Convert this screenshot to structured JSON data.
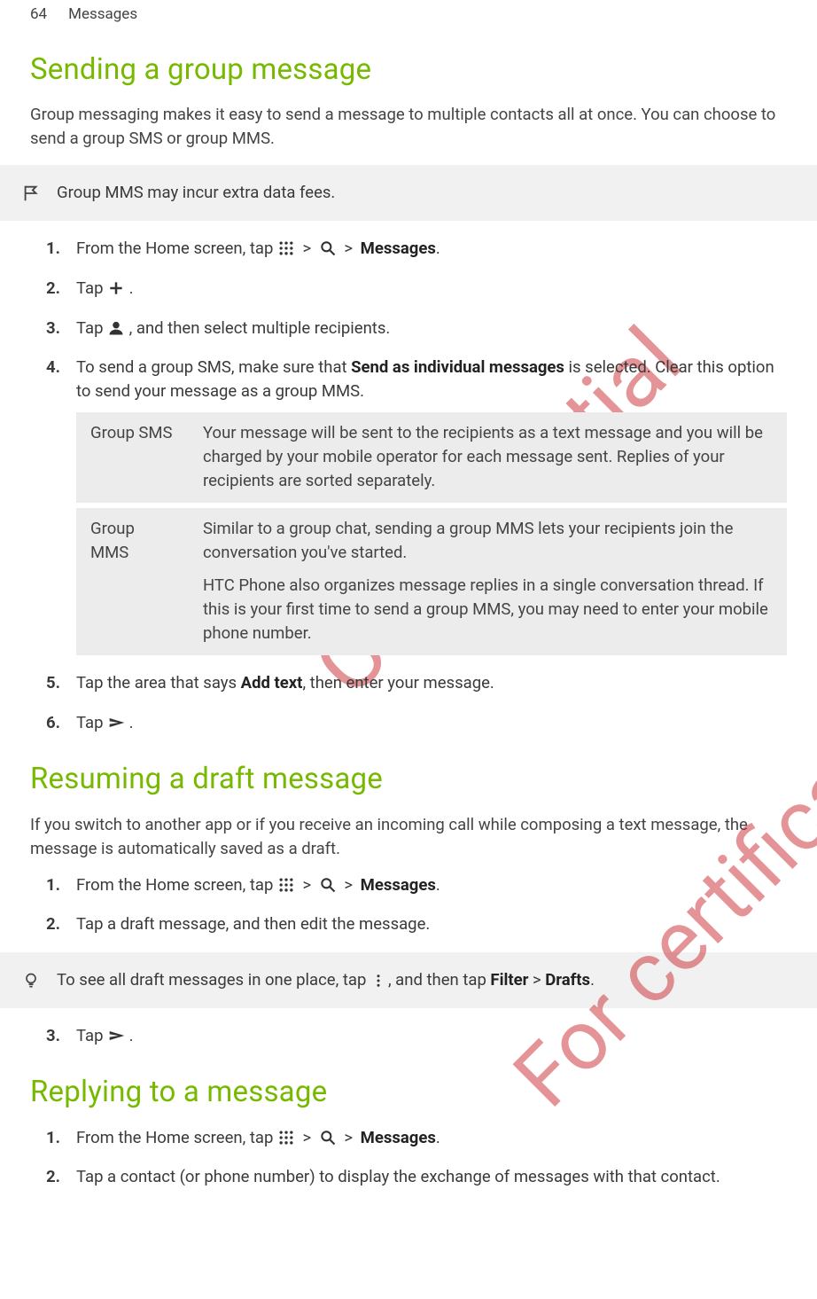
{
  "page_header": {
    "number": "64",
    "section": "Messages"
  },
  "watermarks": {
    "w1": "Confidential",
    "w2": "For certification o"
  },
  "sec1": {
    "title": "Sending a group message",
    "intro": "Group messaging makes it easy to send a message to multiple contacts all at once. You can choose to send a group SMS or group MMS.",
    "note": "Group MMS may incur extra data fees.",
    "steps": {
      "s1": {
        "a": "From the Home screen, tap ",
        "b": " > ",
        "c": " > ",
        "d": "Messages",
        "e": "."
      },
      "s2": {
        "a": "Tap ",
        "b": "."
      },
      "s3": {
        "a": "Tap ",
        "b": ", and then select multiple recipients."
      },
      "s4": {
        "a": "To send a group SMS, make sure that ",
        "b": "Send as individual messages",
        "c": " is selected. Clear this option to send your message as a group MMS."
      },
      "table": {
        "r1_term": "Group SMS",
        "r1_desc": "Your message will be sent to the recipients as a text message and you will be charged by your mobile operator for each message sent. Replies of your recipients are sorted separately.",
        "r2_term": "Group MMS",
        "r2_desc_p1": "Similar to a group chat, sending a group MMS lets your recipients join the conversation you've started.",
        "r2_desc_p2": "HTC Phone also organizes message replies in a single conversation thread. If this is your first time to send a group MMS, you may need to enter your mobile phone number."
      },
      "s5": {
        "a": "Tap the area that says ",
        "b": "Add text",
        "c": ", then enter your message."
      },
      "s6": {
        "a": "Tap ",
        "b": "."
      }
    }
  },
  "sec2": {
    "title": "Resuming a draft message",
    "intro": "If you switch to another app or if you receive an incoming call while composing a text message, the message is automatically saved as a draft.",
    "steps": {
      "s1": {
        "a": "From the Home screen, tap ",
        "b": " > ",
        "c": " > ",
        "d": "Messages",
        "e": "."
      },
      "s2": "Tap a draft message, and then edit the message."
    },
    "tip": {
      "a": "To see all draft messages in one place, tap ",
      "b": ", and then tap ",
      "c": "Filter",
      "d": " > ",
      "e": "Drafts",
      "f": "."
    },
    "steps2": {
      "s3": {
        "a": "Tap ",
        "b": "."
      }
    }
  },
  "sec3": {
    "title": "Replying to a message",
    "steps": {
      "s1": {
        "a": "From the Home screen, tap ",
        "b": " > ",
        "c": " > ",
        "d": "Messages",
        "e": "."
      },
      "s2": "Tap a contact (or phone number) to display the exchange of messages with that contact."
    }
  }
}
